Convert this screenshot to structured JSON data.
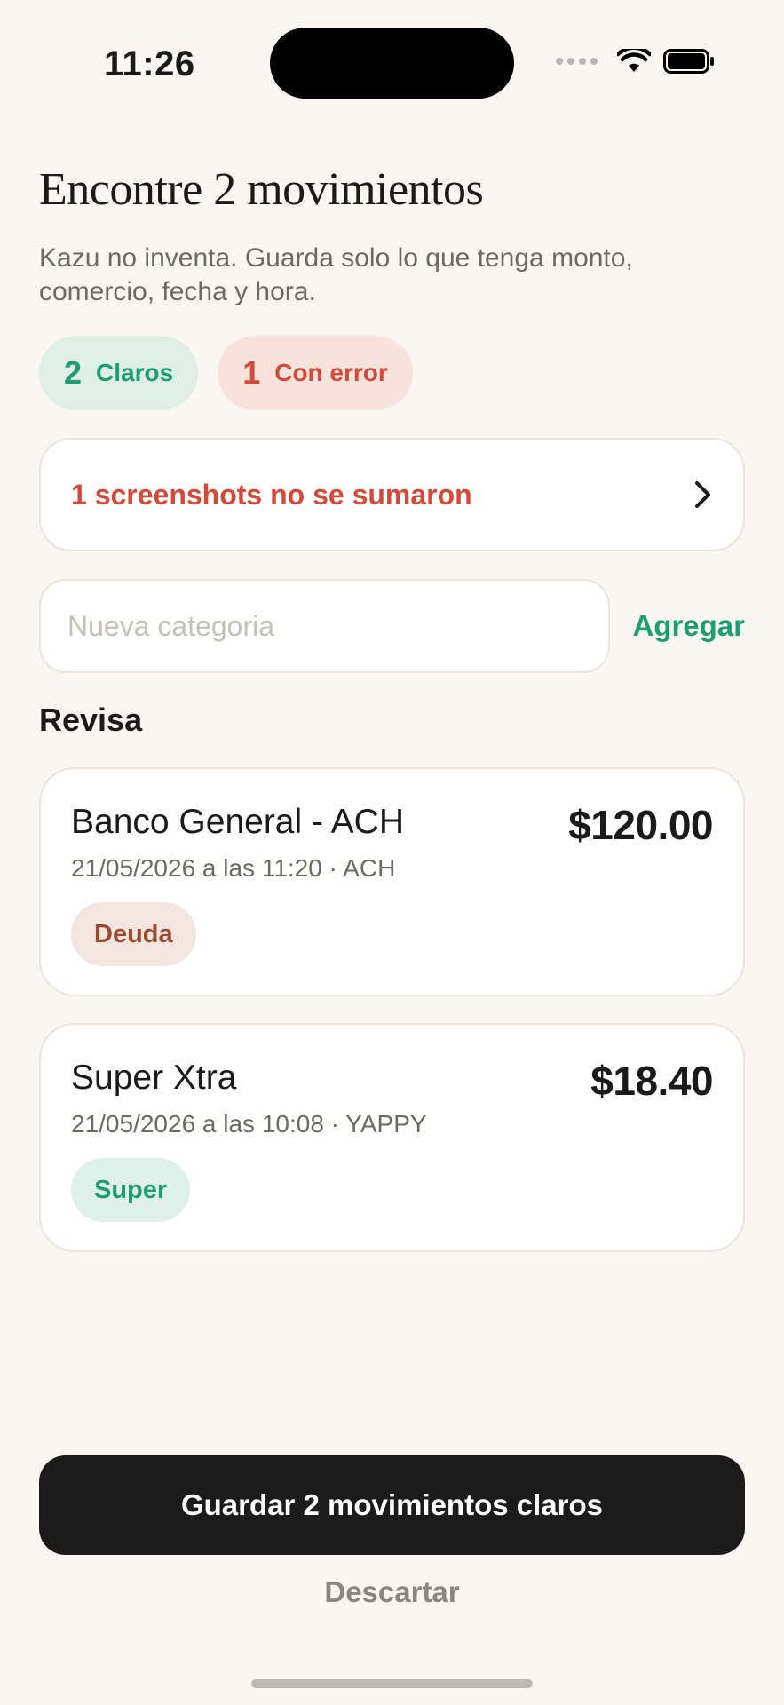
{
  "status_bar": {
    "time": "11:26"
  },
  "header": {
    "title": "Encontre 2 movimientos",
    "subtitle": "Kazu no inventa. Guarda solo lo que tenga monto, comercio, fecha y hora."
  },
  "summary": {
    "clear_count": "2",
    "clear_label": "Claros",
    "error_count": "1",
    "error_label": "Con error",
    "clear_color": "#1f9d72",
    "error_color": "#d24a3a"
  },
  "error_banner": {
    "text": "1 screenshots no se sumaron"
  },
  "category": {
    "placeholder": "Nueva categoria",
    "value": "",
    "add_label": "Agregar"
  },
  "review": {
    "title": "Revisa",
    "items": [
      {
        "merchant": "Banco General - ACH",
        "amount": "$120.00",
        "meta": "21/05/2026 a las 11:20 · ACH",
        "category": "Deuda"
      },
      {
        "merchant": "Super Xtra",
        "amount": "$18.40",
        "meta": "21/05/2026 a las 10:08 · YAPPY",
        "category": "Super"
      }
    ]
  },
  "actions": {
    "save_label": "Guardar 2 movimientos claros",
    "discard_label": "Descartar"
  }
}
